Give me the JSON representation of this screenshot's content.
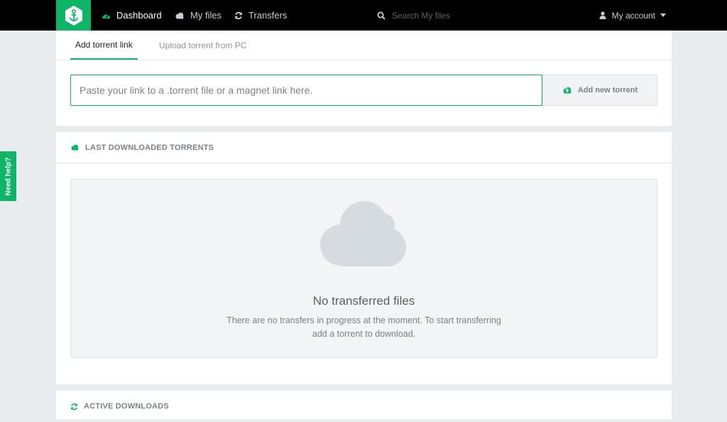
{
  "nav": {
    "items": [
      {
        "label": "Dashboard",
        "icon": "dashboard-icon"
      },
      {
        "label": "My files",
        "icon": "cloud-icon"
      },
      {
        "label": "Transfers",
        "icon": "refresh-icon"
      }
    ],
    "search_placeholder": "Search My files",
    "account_label": "My account"
  },
  "tabs": {
    "add_link": "Add torrent link",
    "upload": "Upload torrent from PC"
  },
  "add_form": {
    "placeholder": "Paste your link to a .torrent file or a magnet link here.",
    "button_label": "Add new torrent"
  },
  "last_downloaded": {
    "title": "LAST DOWNLOADED TORRENTS",
    "empty_title": "No transferred files",
    "empty_text": "There are no transfers in progress at the moment. To start transferring add a torrent to download."
  },
  "active_downloads": {
    "title": "ACTIVE DOWNLOADS"
  },
  "need_help": "Need help?",
  "colors": {
    "brand": "#0eb566",
    "topbar": "#000000",
    "background": "#e9ecef"
  }
}
